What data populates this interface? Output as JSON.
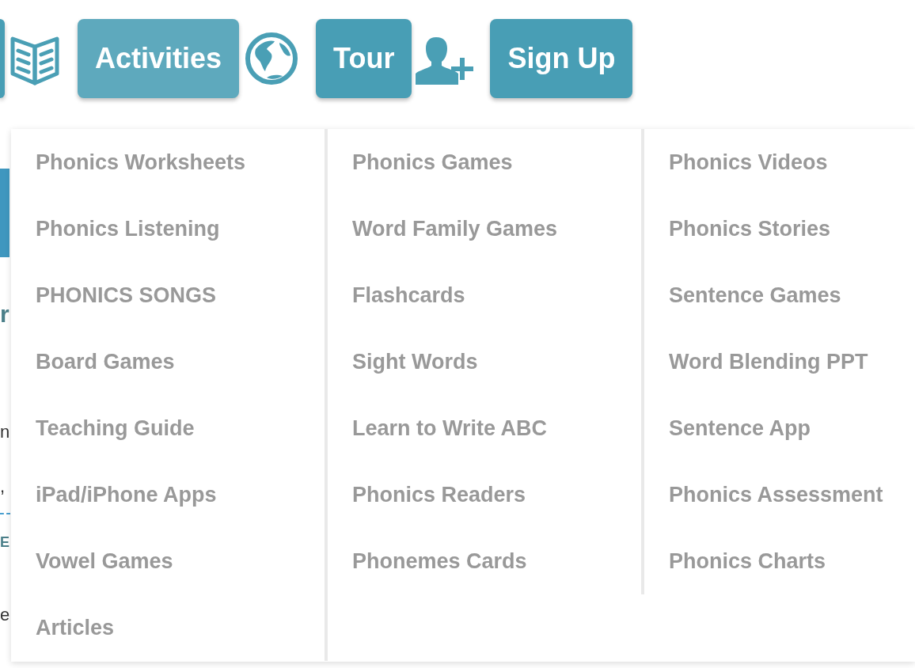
{
  "nav": {
    "buttons": [
      {
        "label": "Activities",
        "selected": true
      },
      {
        "label": "Tour",
        "selected": false
      },
      {
        "label": "Sign Up",
        "selected": false
      }
    ]
  },
  "background_page": {
    "fragments": [
      {
        "kind": "heading",
        "text": "r"
      },
      {
        "kind": "body",
        "text": "n"
      },
      {
        "kind": "body",
        "text": ","
      },
      {
        "kind": "heading",
        "text": "E"
      },
      {
        "kind": "body",
        "text": "e"
      }
    ]
  },
  "dropdown": {
    "columns": [
      {
        "items": [
          "Phonics Worksheets",
          "Phonics Listening",
          "PHONICS SONGS",
          "Board Games",
          "Teaching Guide",
          "iPad/iPhone Apps",
          "Vowel Games",
          "Articles"
        ]
      },
      {
        "items": [
          "Phonics Games",
          "Word Family Games",
          "Flashcards",
          "Sight Words",
          "Learn to Write ABC",
          "Phonics Readers",
          "Phonemes Cards"
        ]
      },
      {
        "items": [
          "Phonics Videos",
          "Phonics Stories",
          "Sentence Games",
          "Word Blending PPT",
          "Sentence App",
          "Phonics Assessment",
          "Phonics Charts"
        ]
      }
    ]
  }
}
